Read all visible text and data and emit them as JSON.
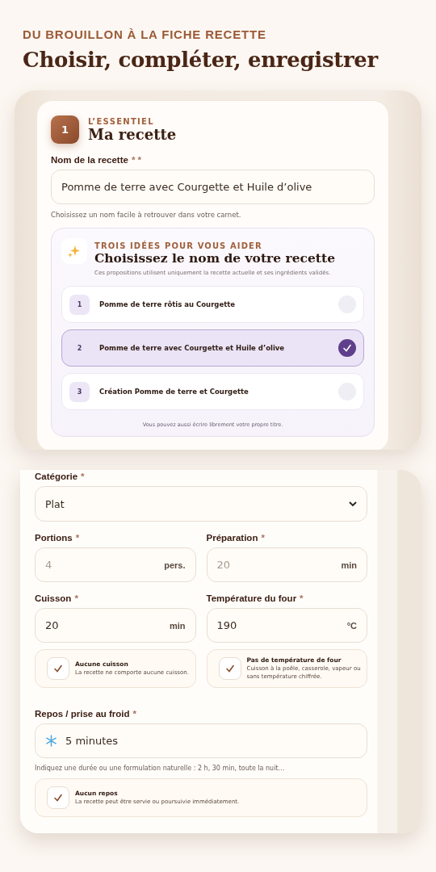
{
  "eyebrow": "DU BROUILLON À LA FICHE RECETTE",
  "title": "Choisir, compléter, enregistrer",
  "essentials": {
    "step": "1",
    "kicker": "L’ESSENTIEL",
    "heading": "Ma recette",
    "name_field": {
      "label": "Nom de la recette",
      "required_mark": "* *",
      "value": "Pomme de terre avec Courgette et Huile d’olive",
      "hint": "Choisissez un nom facile à retrouver dans votre carnet."
    },
    "suggestions": {
      "kicker": "TROIS IDÉES POUR VOUS AIDER",
      "heading": "Choisissez le nom de votre recette",
      "description": "Ces propositions utilisent uniquement la recette actuelle et ses ingrédients validés.",
      "items": [
        {
          "number": "1",
          "label": "Pomme de terre rôtis au Courgette",
          "selected": false
        },
        {
          "number": "2",
          "label": "Pomme de terre avec Courgette et Huile d’olive",
          "selected": true
        },
        {
          "number": "3",
          "label": "Création Pomme de terre et Courgette",
          "selected": false
        }
      ],
      "footer": "Vous pouvez aussi écrire librement votre propre titre."
    }
  },
  "details": {
    "category": {
      "label": "Catégorie",
      "required_mark": "*",
      "value": "Plat"
    },
    "fields": [
      {
        "label": "Portions",
        "required_mark": "*",
        "placeholder": "4",
        "unit": "pers."
      },
      {
        "label": "Préparation",
        "required_mark": "*",
        "placeholder": "20",
        "unit": "min"
      },
      {
        "label": "Cuisson",
        "required_mark": "*",
        "value": "20",
        "unit": "min"
      },
      {
        "label": "Température du four",
        "required_mark": "*",
        "value": "190",
        "unit": "°C"
      }
    ],
    "toggles": [
      {
        "title": "Aucune cuisson",
        "description": "La recette ne comporte aucune cuisson.",
        "checked": true
      },
      {
        "title": "Pas de température de four",
        "description": "Cuisson à la poêle, casserole, vapeur ou sans température chiffrée.",
        "checked": true
      }
    ],
    "rest": {
      "label": "Repos / prise au froid",
      "required_mark": "*",
      "value": "5 minutes",
      "hint": "Indiquez une durée ou une formulation naturelle : 2 h, 30 min, toute la nuit…"
    },
    "rest_toggle": {
      "title": "Aucun repos",
      "description": "La recette peut être servie ou poursuivie immédiatement.",
      "checked": true
    }
  }
}
